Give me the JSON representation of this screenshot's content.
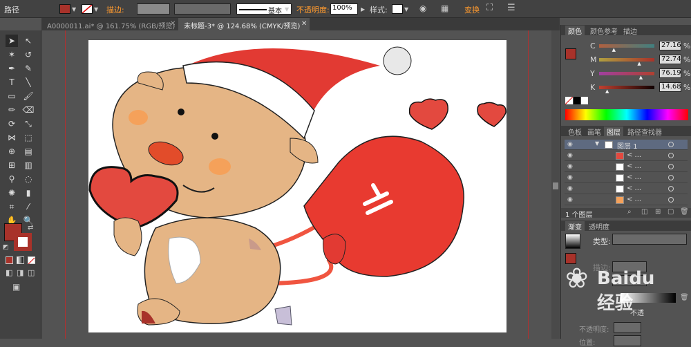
{
  "control_bar": {
    "object_type": "路径",
    "stroke_label": "描边:",
    "brush_style": "基本",
    "opacity_label": "不透明度:",
    "opacity_value": "100%",
    "style_label": "样式:",
    "transform_label": "变换",
    "fill_color": "#a8322a"
  },
  "tabs": [
    {
      "label": "A0000011.ai* @ 161.75% (RGB/预览)"
    },
    {
      "label": "未标题-3* @ 124.68% (CMYK/预览)"
    }
  ],
  "color_panel": {
    "tabs": [
      "颜色",
      "颜色参考",
      "描边"
    ],
    "channels": [
      {
        "name": "C",
        "value": "27.16",
        "level": 0.27
      },
      {
        "name": "M",
        "value": "72.74",
        "level": 0.73
      },
      {
        "name": "Y",
        "value": "76.19",
        "level": 0.76
      },
      {
        "name": "K",
        "value": "14.68",
        "level": 0.15
      }
    ],
    "percent": "%"
  },
  "layers_panel": {
    "tabs": [
      "色板",
      "画笔",
      "图层",
      "路径查找器"
    ],
    "layer_name": "图层 1",
    "sublayers": [
      "< ...",
      "< ...",
      "< ...",
      "< ...",
      "< ..."
    ],
    "footer": "1 个图层"
  },
  "gradient_panel": {
    "tabs": [
      "渐变",
      "透明度"
    ],
    "type_label": "类型:",
    "stroke_label": "描边:",
    "opacity_label": "不透明度:",
    "opacity_short": "不透",
    "location_label": "位置:"
  },
  "watermark": "Baidu 经验"
}
